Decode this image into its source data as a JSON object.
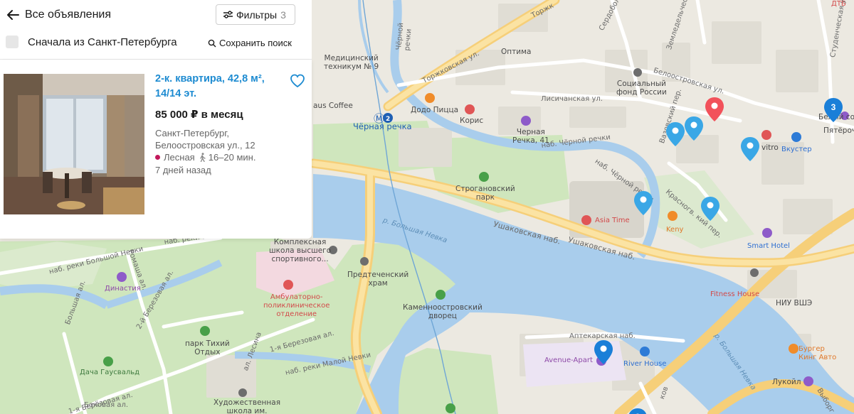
{
  "header": {
    "back_label": "Все объявления",
    "filters_label": "Фильтры",
    "filters_count": "3",
    "spb_first_label": "Сначала из Санкт-Петербурга",
    "save_search_label": "Сохранить поиск"
  },
  "listing": {
    "title": "2-к. квартира, 42,8 м², 14/14 эт.",
    "price": "85 000 ₽ в месяц",
    "city": "Санкт-Петербург,",
    "street": "Белоостровская ул., 12",
    "metro": "Лесная",
    "walk_time": "16–20 мин.",
    "posted": "7 дней назад"
  },
  "map": {
    "cluster_count": "3",
    "corner_label": "ДТБ",
    "labels": {
      "tekhnikum": "Медицинский\nтехникум № 9",
      "chernoy_rechki": "Чёрной\nречки",
      "optima": "Оптима",
      "torzh1": "Торжковская ул.",
      "torzh2": "Торжк",
      "serdob": "Сердобольская",
      "zemle": "Земледельческая ул.",
      "student": "Студенческая ул.",
      "fond": "Социальный\nфонд России",
      "belo_ul": "Белоостровская ул.",
      "belyi": "Белый со...",
      "pyaterochka": "Пятёроч...",
      "coffee": "aus Coffee",
      "metro_station": "Чёрная речка",
      "dodo": "Додо Пицца",
      "koris": "Корис",
      "lisich": "Лисичанская ул.",
      "chernaya41": "Черная\nРечка, 41",
      "vaz": "Вазовский пер.",
      "vitro": "vitro",
      "vkuster": "Вкустер",
      "nab_chr": "наб. Чёрной речки",
      "stroganov": "Строгановский\nпарк",
      "asiatime": "Asia Time",
      "kenny": "Keny",
      "krasn": "Красногв. кий пер.",
      "smart": "Smart Hotel",
      "bolshaya_nevka": "р. Большая Невка",
      "ushak1": "Ушаковская наб.",
      "ushak2": "Ушаковская наб.",
      "kompleks": "Комплексная\nшкола высшего\nспортивного...",
      "predt": "Предтеченский\nхрам",
      "ambul": "Амбулаторно-\nполиклиническое\nотделение",
      "kamen": "Каменноостровский\nдворец",
      "fitness": "Fitness House",
      "niu": "НИУ ВШЭ",
      "dinastia": "Династия",
      "tikhiy": "парк Тихий\nОтдых",
      "gausvald": "Дача Гаусвальд",
      "aptek": "Аптекарская наб.",
      "avenue": "Avenue-Apart",
      "riverhouse": "River House",
      "burger": "Бургер\nКинг Авто",
      "lukoil": "Лукойл",
      "art": "Художественная\nшкола им.",
      "nab_bol_nevki": "наб. реки Большой Невки",
      "nab_bol_nevki2": "наб. реки Большой Невки",
      "nab_mal_nevki": "наб. реки Малой Невки",
      "bereza2": "2-й Березовая ал.",
      "bereza1": "1-я Березовая ал.",
      "bereza1b": "1-я Берёзовая ал.",
      "bokovaya": "Боковая ал.",
      "bolshaya_al": "Большая ал.",
      "lesnaya_al": "ал. Лесина",
      "rom": "Ромаша ал.",
      "mal_nevka": "р. Большая Невка",
      "vyborg": "Выборг",
      "kov": "ков"
    }
  }
}
